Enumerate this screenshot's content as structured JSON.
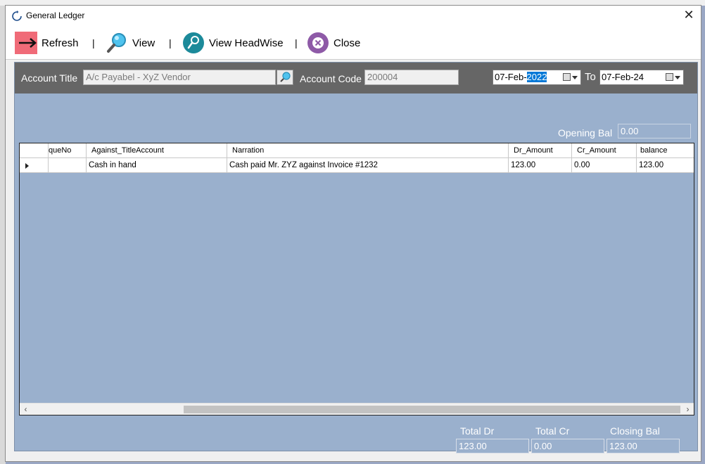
{
  "window": {
    "title": "General Ledger",
    "close_glyph": "✕",
    "icon": "refresh-circle-icon"
  },
  "toolbar": {
    "refresh_label": "Refresh",
    "view_label": "View",
    "view_headwise_label": "View HeadWise",
    "close_label": "Close",
    "separator": "|"
  },
  "filters": {
    "account_title_label": "Account Title",
    "account_title_value": "A/c Payabel - XyZ Vendor",
    "account_code_label": "Account Code",
    "account_code_value": "200004",
    "date_from_prefix": "07-Feb-",
    "date_from_selected": "2022",
    "to_label": "To",
    "date_to": "07-Feb-24"
  },
  "opening": {
    "label": "Opening Bal",
    "value": "0.00"
  },
  "grid": {
    "columns": [
      "queNo",
      "Against_TitleAccount",
      "Narration",
      "Dr_Amount",
      "Cr_Amount",
      "balance"
    ],
    "rows": [
      {
        "queNo": "",
        "against": "Cash in hand",
        "narration": "Cash paid Mr. ZYZ against Invoice #1232",
        "dr": "123.00",
        "cr": "0.00",
        "balance": "123.00"
      }
    ]
  },
  "totals": {
    "total_dr_label": "Total Dr",
    "total_dr_value": "123.00",
    "total_cr_label": "Total Cr",
    "total_cr_value": "0.00",
    "closing_bal_label": "Closing Bal",
    "closing_bal_value": "123.00"
  },
  "colors": {
    "content_bg": "#9ab0cd",
    "header_bar": "#666666",
    "refresh_icon": "#f06b78",
    "view_headwise_icon": "#1c8a9a",
    "close_icon": "#8e5aa7"
  }
}
